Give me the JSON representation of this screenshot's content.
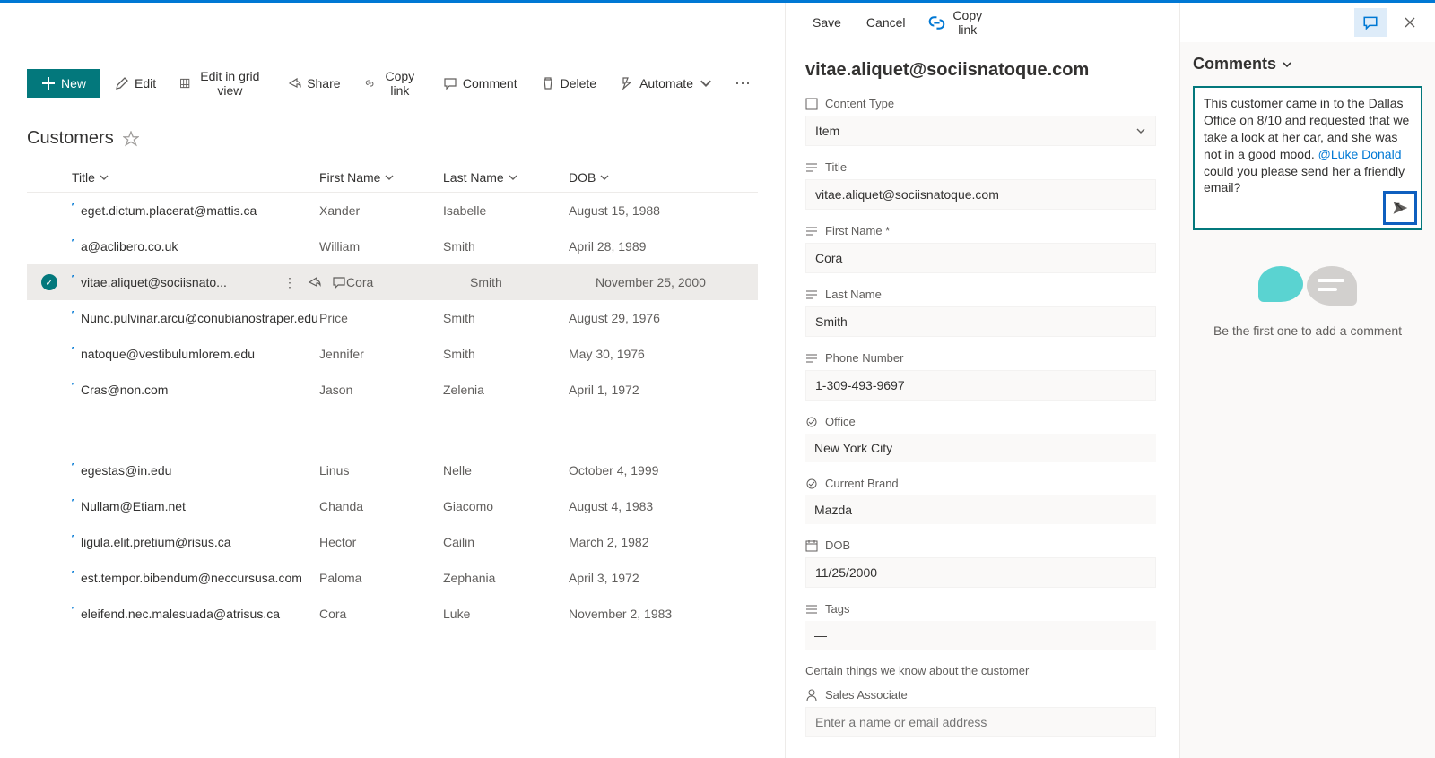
{
  "toolbar": {
    "new": "New",
    "edit": "Edit",
    "editGrid": "Edit in grid view",
    "share": "Share",
    "copyLink": "Copy link",
    "comment": "Comment",
    "delete": "Delete",
    "automate": "Automate"
  },
  "list": {
    "title": "Customers",
    "columns": {
      "title": "Title",
      "firstName": "First Name",
      "lastName": "Last Name",
      "dob": "DOB"
    },
    "rows": [
      {
        "title": "eget.dictum.placerat@mattis.ca",
        "fn": "Xander",
        "ln": "Isabelle",
        "dob": "August 15, 1988"
      },
      {
        "title": "a@aclibero.co.uk",
        "fn": "William",
        "ln": "Smith",
        "dob": "April 28, 1989"
      },
      {
        "title": "vitae.aliquet@sociisnato...",
        "fn": "Cora",
        "ln": "Smith",
        "dob": "November 25, 2000",
        "selected": true
      },
      {
        "title": "Nunc.pulvinar.arcu@conubianostraper.edu",
        "fn": "Price",
        "ln": "Smith",
        "dob": "August 29, 1976"
      },
      {
        "title": "natoque@vestibulumlorem.edu",
        "fn": "Jennifer",
        "ln": "Smith",
        "dob": "May 30, 1976"
      },
      {
        "title": "Cras@non.com",
        "fn": "Jason",
        "ln": "Zelenia",
        "dob": "April 1, 1972"
      },
      {
        "title": "egestas@in.edu",
        "fn": "Linus",
        "ln": "Nelle",
        "dob": "October 4, 1999",
        "gapBefore": true
      },
      {
        "title": "Nullam@Etiam.net",
        "fn": "Chanda",
        "ln": "Giacomo",
        "dob": "August 4, 1983"
      },
      {
        "title": "ligula.elit.pretium@risus.ca",
        "fn": "Hector",
        "ln": "Cailin",
        "dob": "March 2, 1982"
      },
      {
        "title": "est.tempor.bibendum@neccursusa.com",
        "fn": "Paloma",
        "ln": "Zephania",
        "dob": "April 3, 1972"
      },
      {
        "title": "eleifend.nec.malesuada@atrisus.ca",
        "fn": "Cora",
        "ln": "Luke",
        "dob": "November 2, 1983"
      }
    ]
  },
  "details": {
    "save": "Save",
    "cancel": "Cancel",
    "copyLink": "Copy link",
    "itemTitle": "vitae.aliquet@sociisnatoque.com",
    "fields": {
      "contentTypeLabel": "Content Type",
      "contentTypeValue": "Item",
      "titleLabel": "Title",
      "titleValue": "vitae.aliquet@sociisnatoque.com",
      "firstNameLabel": "First Name *",
      "firstNameValue": "Cora",
      "lastNameLabel": "Last Name",
      "lastNameValue": "Smith",
      "phoneLabel": "Phone Number",
      "phoneValue": "1-309-493-9697",
      "officeLabel": "Office",
      "officeValue": "New York City",
      "brandLabel": "Current Brand",
      "brandValue": "Mazda",
      "dobLabel": "DOB",
      "dobValue": "11/25/2000",
      "tagsLabel": "Tags",
      "tagsValue": "—",
      "sectionNote": "Certain things we know about the customer",
      "salesAssocLabel": "Sales Associate",
      "salesAssocPlaceholder": "Enter a name or email address"
    }
  },
  "comments": {
    "header": "Comments",
    "draftBefore": "This customer came in to the Dallas Office on 8/10 and requested that we take a look at her car, and she was not in a good mood. ",
    "mention": "@Luke Donald",
    "draftAfter": " could you please send her a friendly email?",
    "empty": "Be the first one to add a comment"
  }
}
